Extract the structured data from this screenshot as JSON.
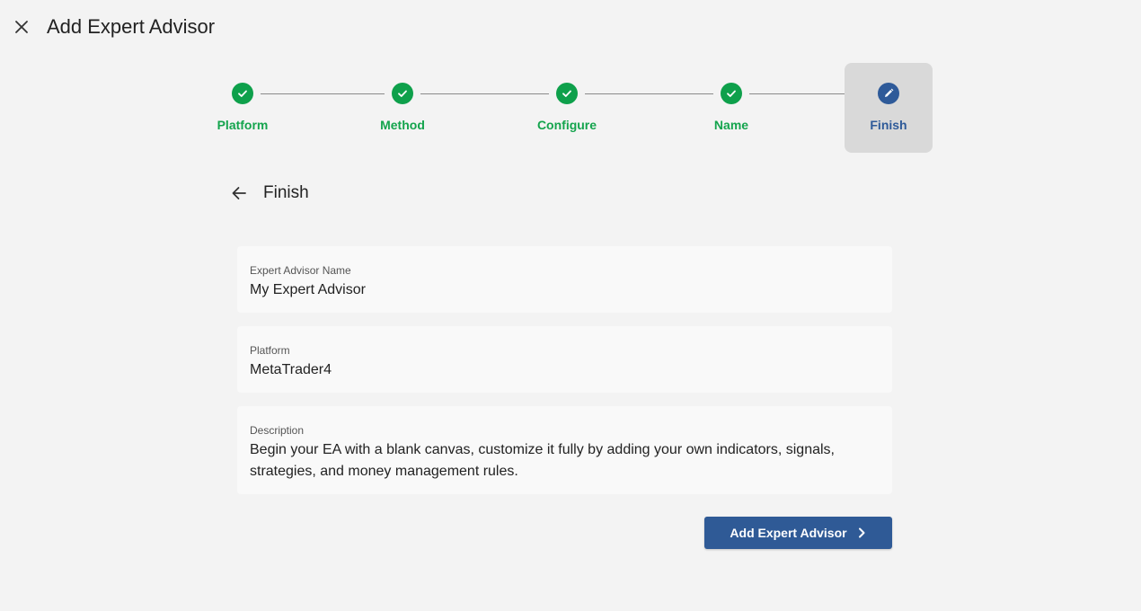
{
  "header": {
    "title": "Add Expert Advisor"
  },
  "stepper": {
    "steps": [
      {
        "label": "Platform",
        "state": "completed"
      },
      {
        "label": "Method",
        "state": "completed"
      },
      {
        "label": "Configure",
        "state": "completed"
      },
      {
        "label": "Name",
        "state": "completed"
      },
      {
        "label": "Finish",
        "state": "current"
      }
    ]
  },
  "section": {
    "title": "Finish"
  },
  "fields": {
    "name": {
      "label": "Expert Advisor Name",
      "value": "My Expert Advisor"
    },
    "platform": {
      "label": "Platform",
      "value": "MetaTrader4"
    },
    "description": {
      "label": "Description",
      "value": "Begin your EA with a blank canvas, customize it fully by adding your own indicators, signals, strategies, and money management rules."
    }
  },
  "actions": {
    "submit_label": "Add Expert Advisor"
  },
  "colors": {
    "completed": "#14a44d",
    "current": "#2e5a99",
    "button": "#2f5a96",
    "background": "#f3f3f3"
  },
  "icons": {
    "close": "close-icon",
    "completed": "check-icon",
    "current": "pencil-icon",
    "back": "arrow-left-icon",
    "submit": "chevron-right-icon"
  }
}
